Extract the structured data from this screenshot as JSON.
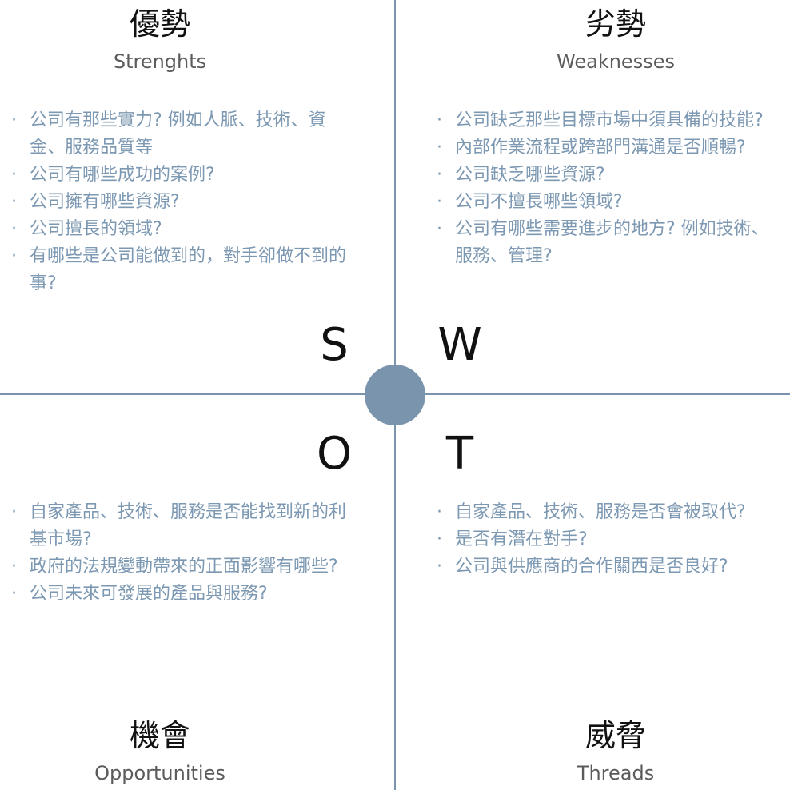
{
  "letters": {
    "s": "S",
    "w": "W",
    "o": "O",
    "t": "T"
  },
  "strengths": {
    "title": "優勢",
    "subtitle": "Strenghts",
    "items": [
      "公司有那些實力? 例如人脈、技術、資金、服務品質等",
      "公司有哪些成功的案例?",
      "公司擁有哪些資源?",
      "公司擅長的領域?",
      "有哪些是公司能做到的，對手卻做不到的事?"
    ]
  },
  "weaknesses": {
    "title": "劣勢",
    "subtitle": "Weaknesses",
    "items": [
      "公司缺乏那些目標市場中須具備的技能?",
      "內部作業流程或跨部門溝通是否順暢?",
      "公司缺乏哪些資源?",
      "公司不擅長哪些領域?",
      "公司有哪些需要進步的地方? 例如技術、服務、管理?"
    ]
  },
  "opportunities": {
    "title": "機會",
    "subtitle": "Opportunities",
    "items": [
      "自家產品、技術、服務是否能找到新的利基市場?",
      "政府的法規變動帶來的正面影響有哪些?",
      "公司未來可發展的產品與服務?"
    ]
  },
  "threats": {
    "title": "威脅",
    "subtitle": "Threads",
    "items": [
      "自家產品、技術、服務是否會被取代?",
      "是否有潛在對手?",
      "公司與供應商的合作關西是否良好?"
    ]
  },
  "colors": {
    "axis": "#7b94ad",
    "bullet_text": "#7c98b2",
    "title": "#111111",
    "subtitle": "#5b5b5b"
  }
}
